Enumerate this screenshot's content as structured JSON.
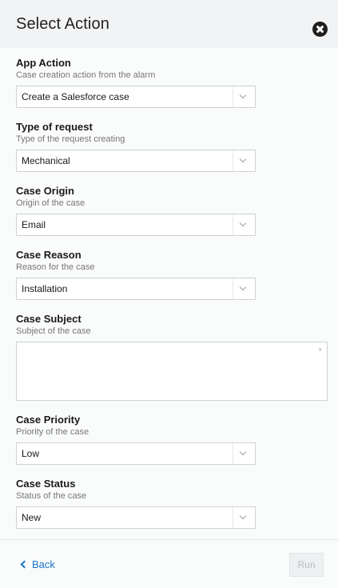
{
  "header": {
    "title": "Select Action"
  },
  "fields": {
    "app_action": {
      "label": "App Action",
      "sub": "Case creation action from the alarm",
      "value": "Create a Salesforce case"
    },
    "type_of_request": {
      "label": "Type of request",
      "sub": "Type of the request creating",
      "value": "Mechanical"
    },
    "case_origin": {
      "label": "Case Origin",
      "sub": "Origin of the case",
      "value": "Email"
    },
    "case_reason": {
      "label": "Case Reason",
      "sub": "Reason for the case",
      "value": "Installation"
    },
    "case_subject": {
      "label": "Case Subject",
      "sub": "Subject of the case",
      "value": "",
      "required_mark": "*"
    },
    "case_priority": {
      "label": "Case Priority",
      "sub": "Priority of the case",
      "value": "Low"
    },
    "case_status": {
      "label": "Case Status",
      "sub": "Status of the case",
      "value": "New"
    }
  },
  "footer": {
    "back_label": "Back",
    "run_label": "Run"
  },
  "icons": {
    "close": "close-icon",
    "back": "chevron-left-icon",
    "dropdown": "chevron-down-icon"
  },
  "colors": {
    "header_bg": "#f2f3f4",
    "link": "#1a73c8",
    "disabled_text": "#b9bcbf"
  }
}
